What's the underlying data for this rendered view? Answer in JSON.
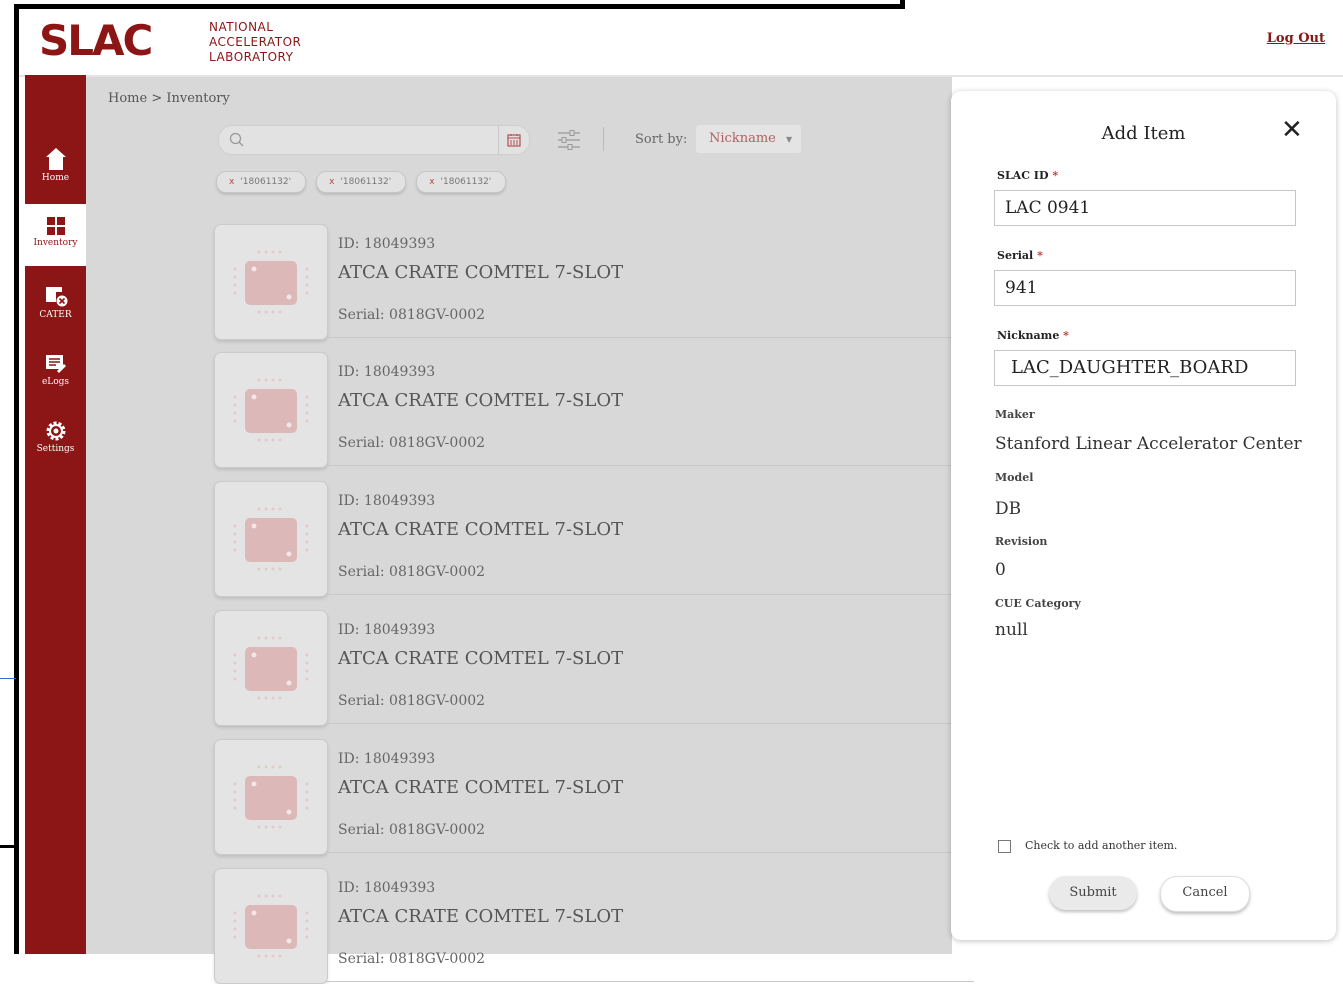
{
  "header": {
    "logo_mark": "SLAC",
    "logo_line1": "NATIONAL",
    "logo_line2": "ACCELERATOR",
    "logo_line3": "LABORATORY",
    "logout": "Log Out"
  },
  "sidebar": {
    "items": [
      {
        "label": "Home",
        "icon": "home-icon"
      },
      {
        "label": "Inventory",
        "icon": "grid-icon"
      },
      {
        "label": "CATER",
        "icon": "cater-icon"
      },
      {
        "label": "eLogs",
        "icon": "elogs-icon"
      },
      {
        "label": "Settings",
        "icon": "gear-icon"
      }
    ]
  },
  "main": {
    "breadcrumb": "Home > Inventory",
    "search_placeholder": "",
    "sort_label": "Sort by:",
    "sort_value": "Nickname",
    "chips": [
      {
        "x": "x",
        "text": "'18061132'"
      },
      {
        "x": "x",
        "text": "'18061132'"
      },
      {
        "x": "x",
        "text": "'18061132'"
      }
    ],
    "items": [
      {
        "id": "ID: 18049393",
        "name": "ATCA CRATE COMTEL 7-SLOT",
        "serial": "Serial: 0818GV-0002"
      },
      {
        "id": "ID: 18049393",
        "name": "ATCA CRATE COMTEL 7-SLOT",
        "serial": "Serial: 0818GV-0002"
      },
      {
        "id": "ID: 18049393",
        "name": "ATCA CRATE COMTEL 7-SLOT",
        "serial": "Serial: 0818GV-0002"
      },
      {
        "id": "ID: 18049393",
        "name": "ATCA CRATE COMTEL 7-SLOT",
        "serial": "Serial: 0818GV-0002"
      },
      {
        "id": "ID: 18049393",
        "name": "ATCA CRATE COMTEL 7-SLOT",
        "serial": "Serial: 0818GV-0002"
      },
      {
        "id": "ID: 18049393",
        "name": "ATCA CRATE COMTEL 7-SLOT",
        "serial": "Serial: 0818GV-0002"
      }
    ]
  },
  "panel": {
    "title": "Add Item",
    "close": "✕",
    "required_mark": "*",
    "slac_id_label": "SLAC ID",
    "slac_id_value": "LAC 0941",
    "serial_label": "Serial",
    "serial_value": "941",
    "nickname_label": "Nickname",
    "nickname_value": "LAC_DAUGHTER_BOARD",
    "maker_label": "Maker",
    "maker_value": "Stanford Linear Accelerator Center",
    "model_label": "Model",
    "model_value": "DB",
    "revision_label": "Revision",
    "revision_value": "0",
    "cue_label": "CUE Category",
    "cue_value": "null",
    "check_label": "Check to add another item.",
    "submit": "Submit",
    "cancel": "Cancel"
  },
  "colors": {
    "brand": "#8c1515",
    "required": "#c0392b"
  }
}
